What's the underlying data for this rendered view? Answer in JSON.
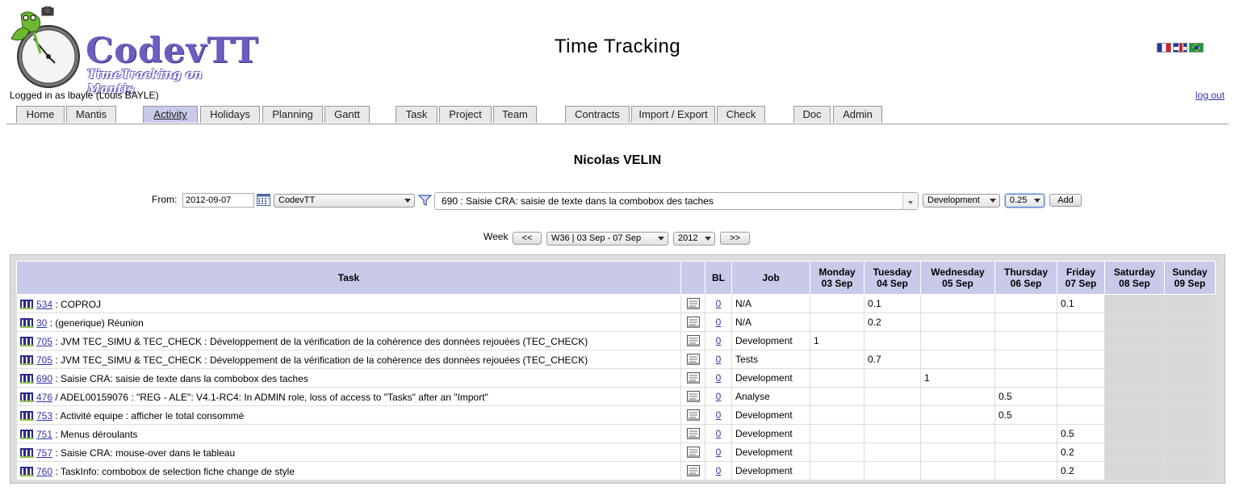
{
  "app": {
    "logo_name": "CodevTT",
    "logo_subtitle": "TimeTracking on Mantis",
    "page_title": "Time Tracking",
    "logged_in": "Logged in as lbayle (Louis BAYLE)",
    "logout": "log out",
    "languages": [
      "fr-flag-icon",
      "uk-flag-icon",
      "br-flag-icon"
    ]
  },
  "menu": [
    {
      "label": "Home"
    },
    {
      "label": "Mantis"
    },
    {
      "label": "Activity",
      "active": true
    },
    {
      "label": "Holidays"
    },
    {
      "label": "Planning"
    },
    {
      "label": "Gantt"
    },
    {
      "label": "Task"
    },
    {
      "label": "Project"
    },
    {
      "label": "Team"
    },
    {
      "label": "Contracts"
    },
    {
      "label": "Import / Export"
    },
    {
      "label": "Check"
    },
    {
      "label": "Doc"
    },
    {
      "label": "Admin"
    }
  ],
  "user_name": "Nicolas VELIN",
  "form": {
    "from_label": "From:",
    "date": "2012-09-07",
    "project": "CodevTT",
    "task": "690 : Saisie CRA: saisie de texte dans la combobox des taches",
    "job": "Development",
    "duration": "0.25",
    "add": "Add"
  },
  "week": {
    "label": "Week",
    "prev": "<<",
    "week_select": "W36 | 03 Sep - 07 Sep",
    "year_select": "2012",
    "next": ">>"
  },
  "table": {
    "headers": {
      "task": "Task",
      "bl": "BL",
      "job": "Job",
      "days": [
        {
          "day": "Monday",
          "date": "03 Sep"
        },
        {
          "day": "Tuesday",
          "date": "04 Sep"
        },
        {
          "day": "Wednesday",
          "date": "05 Sep"
        },
        {
          "day": "Thursday",
          "date": "06 Sep"
        },
        {
          "day": "Friday",
          "date": "07 Sep"
        },
        {
          "day": "Saturday",
          "date": "08 Sep"
        },
        {
          "day": "Sunday",
          "date": "09 Sep"
        }
      ]
    },
    "rows": [
      {
        "id": "534",
        "text": " : COPROJ",
        "bl": "0",
        "job": "N/A",
        "d": [
          "",
          "0.1",
          "",
          "",
          "0.1",
          "",
          ""
        ]
      },
      {
        "id": "30",
        "text": " : (generique) Réunion",
        "bl": "0",
        "job": "N/A",
        "d": [
          "",
          "0.2",
          "",
          "",
          "",
          "",
          ""
        ]
      },
      {
        "id": "705",
        "text": " : JVM TEC_SIMU & TEC_CHECK : Développement de la vérification de la cohérence des données rejouées (TEC_CHECK)",
        "bl": "0",
        "job": "Development",
        "d": [
          "1",
          "",
          "",
          "",
          "",
          "",
          ""
        ]
      },
      {
        "id": "705",
        "text": " : JVM TEC_SIMU & TEC_CHECK : Développement de la vérification de la cohérence des données rejouées (TEC_CHECK)",
        "bl": "0",
        "job": "Tests",
        "d": [
          "",
          "0.7",
          "",
          "",
          "",
          "",
          ""
        ]
      },
      {
        "id": "690",
        "text": " : Saisie CRA: saisie de texte dans la combobox des taches",
        "bl": "0",
        "job": "Development",
        "d": [
          "",
          "",
          "1",
          "",
          "",
          "",
          ""
        ]
      },
      {
        "id": "476",
        "text": " / ADEL00159076 : \"REG - ALE\": V4.1-RC4: In ADMIN role, loss of access to \"Tasks\" after an \"Import\"",
        "bl": "0",
        "job": "Analyse",
        "d": [
          "",
          "",
          "",
          "0.5",
          "",
          "",
          ""
        ]
      },
      {
        "id": "753",
        "text": " : Activité equipe : afficher le total consommé",
        "bl": "0",
        "job": "Development",
        "d": [
          "",
          "",
          "",
          "0.5",
          "",
          "",
          ""
        ]
      },
      {
        "id": "751",
        "text": " : Menus déroulants",
        "bl": "0",
        "job": "Development",
        "d": [
          "",
          "",
          "",
          "",
          "0.5",
          "",
          ""
        ]
      },
      {
        "id": "757",
        "text": " : Saisie CRA: mouse-over dans le tableau",
        "bl": "0",
        "job": "Development",
        "d": [
          "",
          "",
          "",
          "",
          "0.2",
          "",
          ""
        ]
      },
      {
        "id": "760",
        "text": " : TaskInfo: combobox de selection fiche change de style",
        "bl": "0",
        "job": "Development",
        "d": [
          "",
          "",
          "",
          "",
          "0.2",
          "",
          ""
        ]
      }
    ]
  }
}
